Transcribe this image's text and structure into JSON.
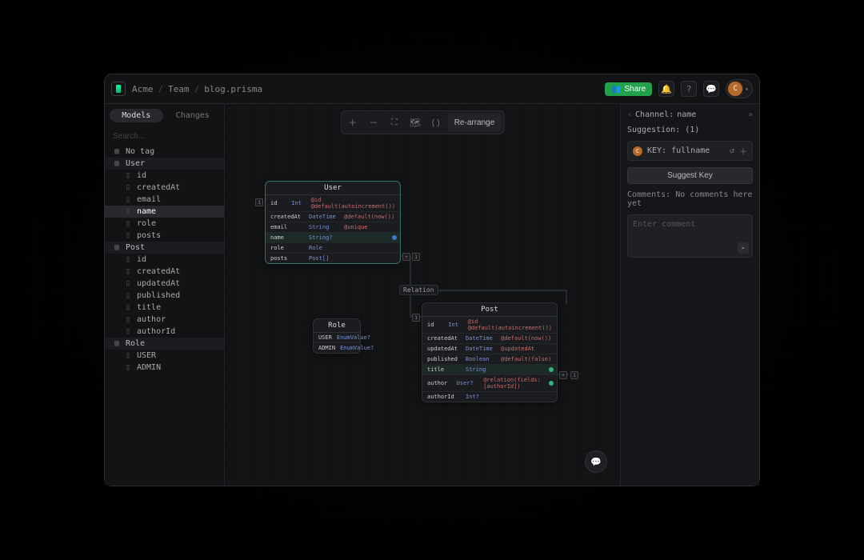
{
  "breadcrumbs": {
    "b0": "Acme",
    "b1": "Team",
    "b2": "blog.prisma",
    "sep": "/"
  },
  "share_label": "Share",
  "avatar_letter": "C",
  "tabs": {
    "models": "Models",
    "changes": "Changes"
  },
  "search_placeholder": "Search...",
  "tree": {
    "no_tag": "No tag",
    "groups": [
      {
        "name": "User",
        "children": [
          "id",
          "createdAt",
          "email",
          "name",
          "role",
          "posts"
        ]
      },
      {
        "name": "Post",
        "children": [
          "id",
          "createdAt",
          "updatedAt",
          "published",
          "title",
          "author",
          "authorId"
        ]
      },
      {
        "name": "Role",
        "children": [
          "USER",
          "ADMIN"
        ]
      }
    ],
    "selected": "name"
  },
  "toolbar": {
    "rearrange": "Re-arrange"
  },
  "models": {
    "user": {
      "title": "User",
      "rows": [
        {
          "name": "id",
          "type": "Int",
          "attr": "@id @default(autoincrement())"
        },
        {
          "name": "createdAt",
          "type": "DateTime",
          "attr": "@default(now())"
        },
        {
          "name": "email",
          "type": "String",
          "attr": "@unique"
        },
        {
          "name": "name",
          "type": "String?",
          "attr": "",
          "hl": true
        },
        {
          "name": "role",
          "type": "Role",
          "attr": ""
        },
        {
          "name": "posts",
          "type": "Post[]",
          "attr": ""
        }
      ]
    },
    "role": {
      "title": "Role",
      "rows": [
        {
          "name": "USER",
          "type": "EnumValue?",
          "attr": ""
        },
        {
          "name": "ADMIN",
          "type": "EnumValue?",
          "attr": ""
        }
      ]
    },
    "post": {
      "title": "Post",
      "rows": [
        {
          "name": "id",
          "type": "Int",
          "attr": "@id @default(autoincrement())"
        },
        {
          "name": "createdAt",
          "type": "DateTime",
          "attr": "@default(now())"
        },
        {
          "name": "updatedAt",
          "type": "DateTime",
          "attr": "@updatedAt"
        },
        {
          "name": "published",
          "type": "Boolean",
          "attr": "@default(false)"
        },
        {
          "name": "title",
          "type": "String",
          "attr": "",
          "hl": true
        },
        {
          "name": "author",
          "type": "User?",
          "attr": "@relation(fields:[authorId])"
        },
        {
          "name": "authorId",
          "type": "Int?",
          "attr": ""
        }
      ]
    }
  },
  "edge_label": "Relation",
  "handles": {
    "one": "1",
    "plus": "+"
  },
  "rpanel": {
    "channel_prefix": "Channel:",
    "channel_name": "name",
    "suggestion_prefix": "Suggestion:",
    "suggestion_count": "(1)",
    "key_label": "KEY: fullname",
    "suggest_btn": "Suggest Key",
    "comments_label": "Comments:",
    "comments_empty": "No comments here yet",
    "comment_placeholder": "Enter comment"
  }
}
